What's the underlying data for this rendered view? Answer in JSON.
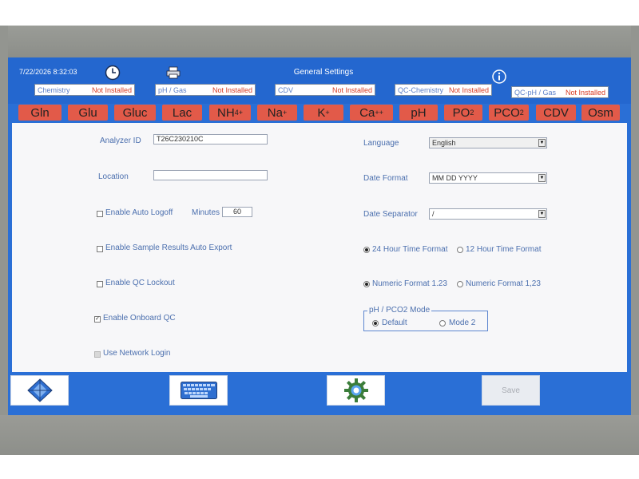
{
  "header": {
    "datetime": "7/22/2026  8:32:03",
    "title": "General Settings",
    "clock_icon": "clock-icon",
    "printer_icon": "printer-icon",
    "info_icon": "info-icon"
  },
  "status_items": [
    {
      "name": "Chemistry",
      "status": "Not Installed"
    },
    {
      "name": "pH / Gas",
      "status": "Not Installed"
    },
    {
      "name": "CDV",
      "status": "Not Installed"
    },
    {
      "name": "QC-Chemistry",
      "status": "Not Installed"
    },
    {
      "name": "QC-pH / Gas",
      "status": "Not Installed"
    }
  ],
  "parameters": [
    {
      "base": "Gln",
      "sub": "",
      "sup": ""
    },
    {
      "base": "Glu",
      "sub": "",
      "sup": ""
    },
    {
      "base": "Gluc",
      "sub": "",
      "sup": ""
    },
    {
      "base": "Lac",
      "sub": "",
      "sup": ""
    },
    {
      "base": "NH",
      "sub": "4",
      "sup": "+"
    },
    {
      "base": "Na",
      "sub": "",
      "sup": "+"
    },
    {
      "base": "K",
      "sub": "",
      "sup": "+"
    },
    {
      "base": "Ca",
      "sub": "",
      "sup": "++"
    },
    {
      "base": "pH",
      "sub": "",
      "sup": ""
    },
    {
      "base": "PO",
      "sub": "2",
      "sup": ""
    },
    {
      "base": "PCO",
      "sub": "2",
      "sup": ""
    },
    {
      "base": "CDV",
      "sub": "",
      "sup": ""
    },
    {
      "base": "Osm",
      "sub": "",
      "sup": ""
    }
  ],
  "form": {
    "analyzer_id_label": "Analyzer ID",
    "analyzer_id_value": "T26C230210C",
    "location_label": "Location",
    "location_value": "",
    "auto_logoff_label": "Enable Auto Logoff",
    "minutes_label": "Minutes",
    "minutes_value": "60",
    "auto_export_label": "Enable Sample Results Auto Export",
    "qc_lockout_label": "Enable QC Lockout",
    "onboard_qc_label": "Enable Onboard QC",
    "network_login_label": "Use Network Login",
    "checked_mark": "✓",
    "language_label": "Language",
    "language_value": "English",
    "date_format_label": "Date Format",
    "date_format_value": "MM DD YYYY",
    "date_separator_label": "Date Separator",
    "date_separator_value": "/",
    "time_24_label": "24 Hour Time Format",
    "time_12_label": "12 Hour Time Format",
    "numeric_123_label": "Numeric Format 1.23",
    "numeric_123_comma_label": "Numeric Format 1,23",
    "ph_pco2_group_label": "pH / PCO2 Mode",
    "mode_default_label": "Default",
    "mode_2_label": "Mode 2"
  },
  "footer": {
    "nav_icon": "navigation-diamond-icon",
    "keyboard_icon": "keyboard-icon",
    "gear_icon": "gear-icon",
    "save_label": "Save"
  },
  "colors": {
    "screen_blue": "#2a6fd6",
    "chip_red": "#e25a49",
    "label_blue": "#4b6fae",
    "status_red": "#d83a22"
  }
}
